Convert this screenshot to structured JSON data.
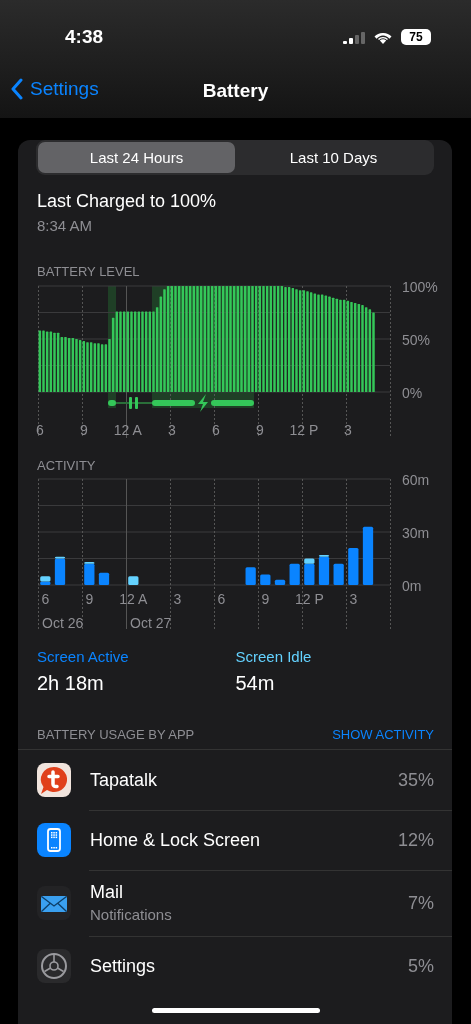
{
  "status_bar": {
    "time": "4:38",
    "battery": "75"
  },
  "nav": {
    "back": "Settings",
    "title": "Battery"
  },
  "tabs": [
    {
      "label": "Last 24 Hours",
      "selected": true
    },
    {
      "label": "Last 10 Days",
      "selected": false
    }
  ],
  "last_charged": {
    "title": "Last Charged to 100%",
    "time": "8:34 AM"
  },
  "battery_level": {
    "heading": "BATTERY LEVEL",
    "chart_data": {
      "type": "bar",
      "ylim": [
        0,
        100
      ],
      "categories": [
        "6",
        null,
        null,
        null,
        null,
        null,
        null,
        null,
        null,
        null,
        null,
        null,
        "9",
        null,
        null,
        null,
        null,
        null,
        null,
        null,
        null,
        null,
        null,
        null,
        "12 A",
        null,
        null,
        null,
        null,
        null,
        null,
        null,
        null,
        null,
        null,
        null,
        "3",
        null,
        null,
        null,
        null,
        null,
        null,
        null,
        null,
        null,
        null,
        null,
        "6",
        null,
        null,
        null,
        null,
        null,
        null,
        null,
        null,
        null,
        null,
        null,
        "9",
        null,
        null,
        null,
        null,
        null,
        null,
        null,
        null,
        null,
        null,
        null,
        "12 P",
        null,
        null,
        null,
        null,
        null,
        null,
        null,
        null,
        null,
        null,
        null,
        "3",
        null,
        null,
        null,
        null,
        null,
        null,
        null,
        null,
        null,
        null,
        null
      ],
      "series": [
        {
          "color": "#34c759",
          "values": [
            58,
            58,
            57,
            57,
            56,
            56,
            52,
            52,
            51,
            51,
            50,
            49,
            48,
            47,
            47,
            46,
            46,
            45,
            45,
            50,
            70,
            76,
            76,
            76,
            76,
            76,
            76,
            76,
            76,
            76,
            76,
            76,
            80,
            90,
            97,
            100,
            100,
            100,
            100,
            100,
            100,
            100,
            100,
            100,
            100,
            100,
            100,
            100,
            100,
            100,
            100,
            100,
            100,
            100,
            100,
            100,
            100,
            100,
            100,
            100,
            100,
            100,
            100,
            100,
            100,
            100,
            100,
            99,
            99,
            98,
            97,
            96,
            96,
            95,
            94,
            93,
            92,
            92,
            91,
            90,
            89,
            88,
            87,
            87,
            86,
            85,
            84,
            83,
            82,
            80,
            78,
            75,
            null,
            null,
            null,
            null
          ]
        }
      ],
      "yticks": [
        {
          "value": 0,
          "label": "0%"
        },
        {
          "value": 50,
          "label": "50%"
        },
        {
          "value": 100,
          "label": "100%"
        }
      ]
    }
  },
  "activity": {
    "heading": "ACTIVITY",
    "dates": [
      "Oct 26",
      "Oct 27"
    ],
    "chart_data": {
      "type": "bar",
      "stacked": true,
      "ylim": [
        0,
        60
      ],
      "categories": [
        "6",
        null,
        null,
        "9",
        null,
        null,
        "12 A",
        null,
        null,
        "3",
        null,
        null,
        "6",
        null,
        null,
        "9",
        null,
        null,
        "12 P",
        null,
        null,
        "3",
        null,
        null
      ],
      "series": [
        {
          "name": "Screen Active",
          "color": "#0a84ff",
          "values": [
            2,
            15,
            0,
            12,
            7,
            0,
            0,
            0,
            0,
            0,
            0,
            0,
            0,
            0,
            10,
            6,
            3,
            12,
            12,
            16,
            12,
            21,
            33,
            null
          ]
        },
        {
          "name": "Screen Idle",
          "color": "#64d2ff",
          "values": [
            3,
            1,
            0,
            1,
            0,
            0,
            5,
            0,
            0,
            0,
            0,
            0,
            0,
            0,
            0,
            0,
            0,
            0,
            3,
            1,
            0,
            0,
            0,
            null
          ]
        }
      ],
      "yticks": [
        {
          "value": 0,
          "label": "0m"
        },
        {
          "value": 30,
          "label": "30m"
        },
        {
          "value": 60,
          "label": "60m"
        }
      ]
    }
  },
  "screen_time": [
    "2h 18m",
    "54m"
  ],
  "usage": {
    "heading": "BATTERY USAGE BY APP",
    "action": "SHOW ACTIVITY",
    "apps": [
      {
        "name": "Tapatalk",
        "percent": "35%",
        "kind": "bubble"
      },
      {
        "name": "Home & Lock Screen",
        "percent": "12%",
        "kind": "phone"
      },
      {
        "name": "Mail",
        "detail": "Notifications",
        "percent": "7%",
        "kind": "mail"
      },
      {
        "name": "Settings",
        "percent": "5%",
        "kind": "gear"
      }
    ]
  }
}
